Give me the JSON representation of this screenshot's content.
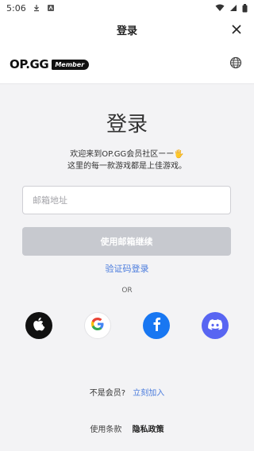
{
  "status": {
    "time": "5:06"
  },
  "nav": {
    "title": "登录"
  },
  "brand": {
    "logo": "OP.GG",
    "badge": "Member"
  },
  "main": {
    "heading": "登录",
    "welcome_line1": "欢迎来到OP.GG会员社区ーー🖐",
    "welcome_line2": "这里的每一款游戏都是上佳游戏。",
    "email_placeholder": "邮箱地址",
    "continue_label": "使用邮箱继续",
    "code_login_label": "验证码登录",
    "or_label": "OR"
  },
  "social": [
    {
      "name": "apple",
      "icon": "apple-icon",
      "color": "#111111"
    },
    {
      "name": "google",
      "icon": "google-icon",
      "color": "#ffffff"
    },
    {
      "name": "facebook",
      "icon": "facebook-icon",
      "color": "#1877f2"
    },
    {
      "name": "discord",
      "icon": "discord-icon",
      "color": "#5865f2"
    }
  ],
  "signup": {
    "prompt": "不是会员?",
    "link": "立刻加入"
  },
  "footer": {
    "terms": "使用条款",
    "privacy": "隐私政策"
  }
}
